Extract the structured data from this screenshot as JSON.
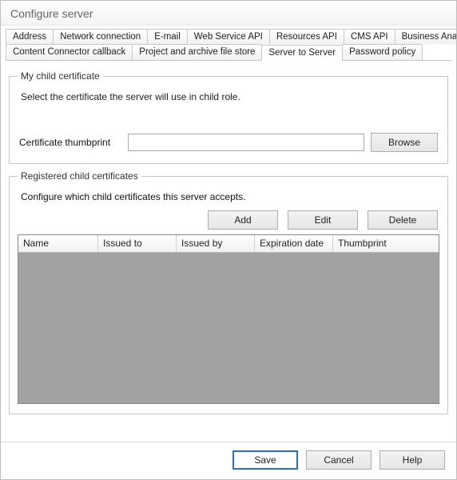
{
  "window": {
    "title": "Configure server"
  },
  "tabs": [
    "Address",
    "Network connection",
    "E-mail",
    "Web Service API",
    "Resources API",
    "CMS API",
    "Business Analytics API",
    "Content Connector callback",
    "Project and archive file store",
    "Server to Server",
    "Password policy"
  ],
  "activeTabIndex": 9,
  "groups": {
    "myChild": {
      "legend": "My child certificate",
      "description": "Select the certificate the server will use in child role.",
      "thumbprintLabel": "Certificate thumbprint",
      "thumbprintValue": "",
      "browseLabel": "Browse"
    },
    "registered": {
      "legend": "Registered child certificates",
      "description": "Configure which child certificates this server accepts.",
      "buttons": {
        "add": "Add",
        "edit": "Edit",
        "delete": "Delete"
      },
      "columns": [
        "Name",
        "Issued to",
        "Issued by",
        "Expiration date",
        "Thumbprint"
      ],
      "rows": []
    }
  },
  "footer": {
    "save": "Save",
    "cancel": "Cancel",
    "help": "Help"
  }
}
